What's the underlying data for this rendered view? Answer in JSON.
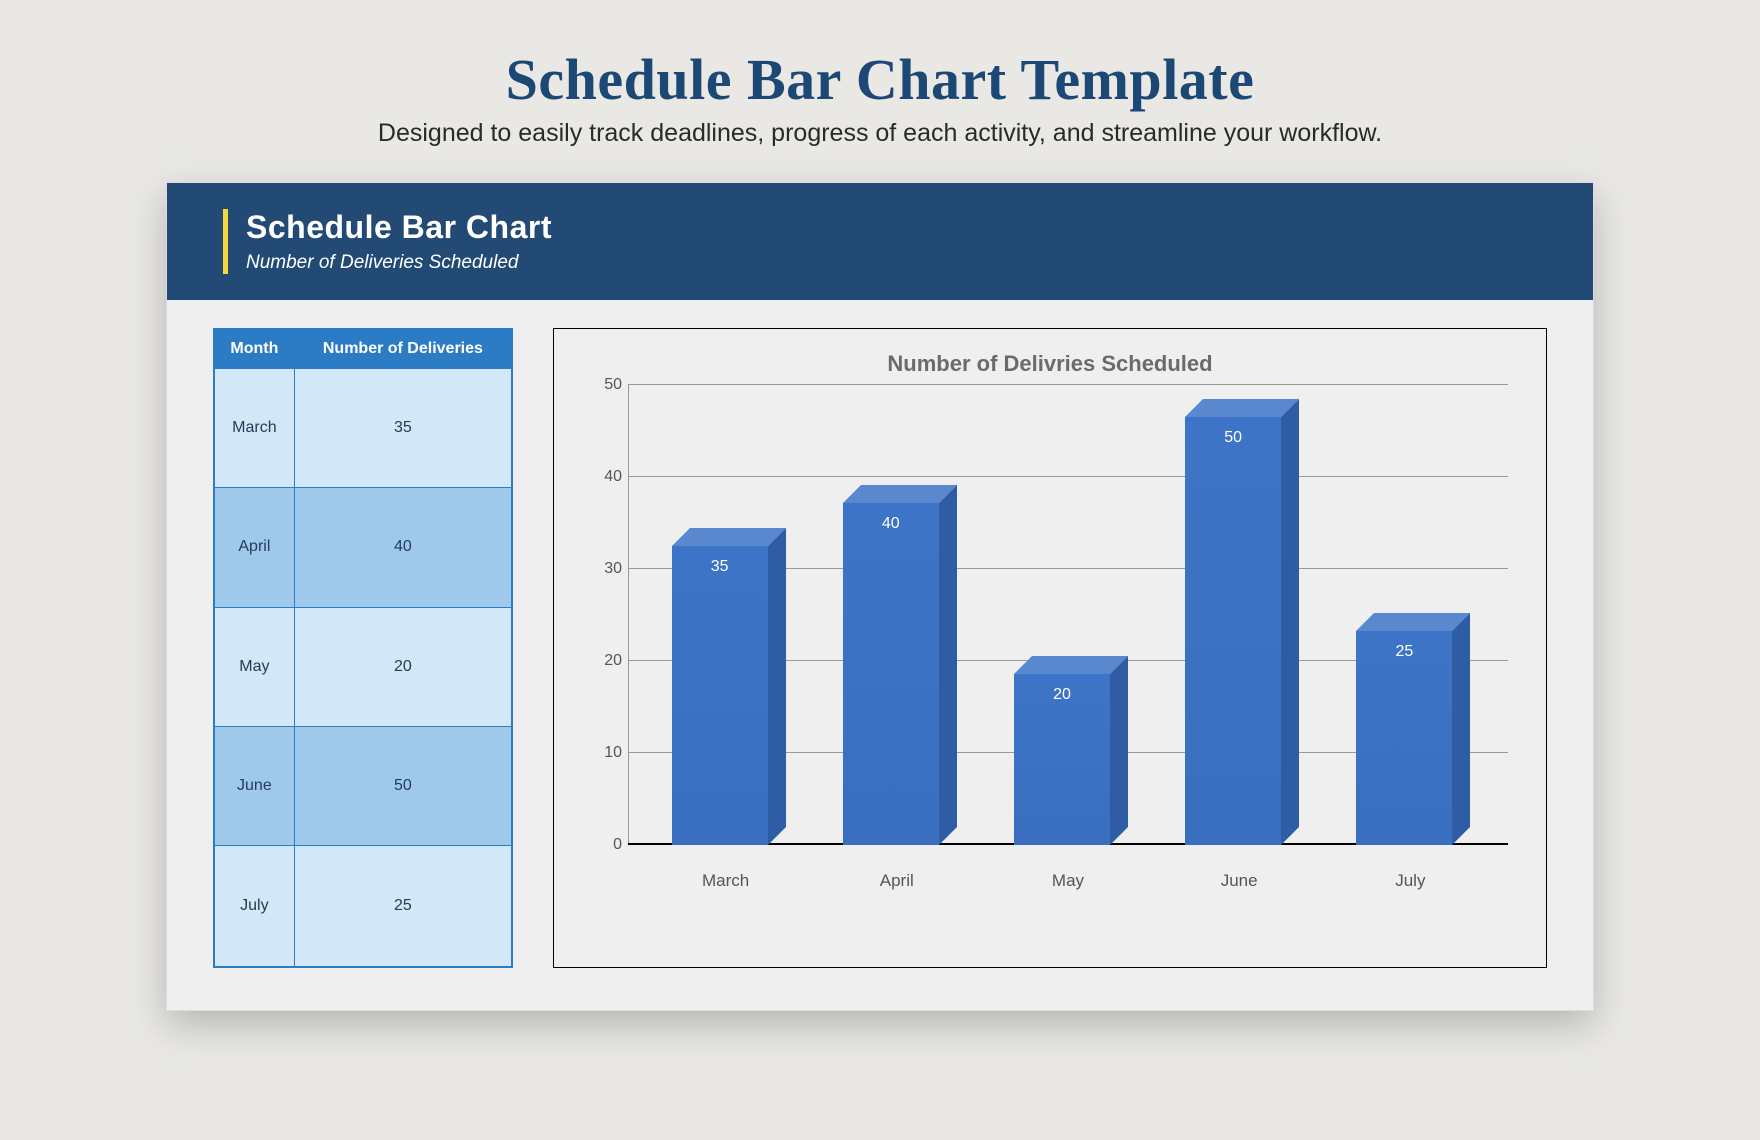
{
  "header": {
    "title": "Schedule Bar Chart Template",
    "subtitle": "Designed to easily track deadlines, progress of each activity, and streamline your workflow."
  },
  "card": {
    "title": "Schedule Bar Chart",
    "subtitle": "Number of Deliveries Scheduled"
  },
  "table": {
    "col1": "Month",
    "col2": "Number of Deliveries",
    "rows": [
      {
        "month": "March",
        "value": "35"
      },
      {
        "month": "April",
        "value": "40"
      },
      {
        "month": "May",
        "value": "20"
      },
      {
        "month": "June",
        "value": "50"
      },
      {
        "month": "July",
        "value": "25"
      }
    ]
  },
  "chart_data": {
    "type": "bar",
    "title": "Number of Delivries Scheduled",
    "xlabel": "",
    "ylabel": "",
    "categories": [
      "March",
      "April",
      "May",
      "June",
      "July"
    ],
    "values": [
      35,
      40,
      20,
      50,
      25
    ],
    "ylim": [
      0,
      50
    ],
    "yticks": [
      0,
      10,
      20,
      30,
      40,
      50
    ]
  }
}
